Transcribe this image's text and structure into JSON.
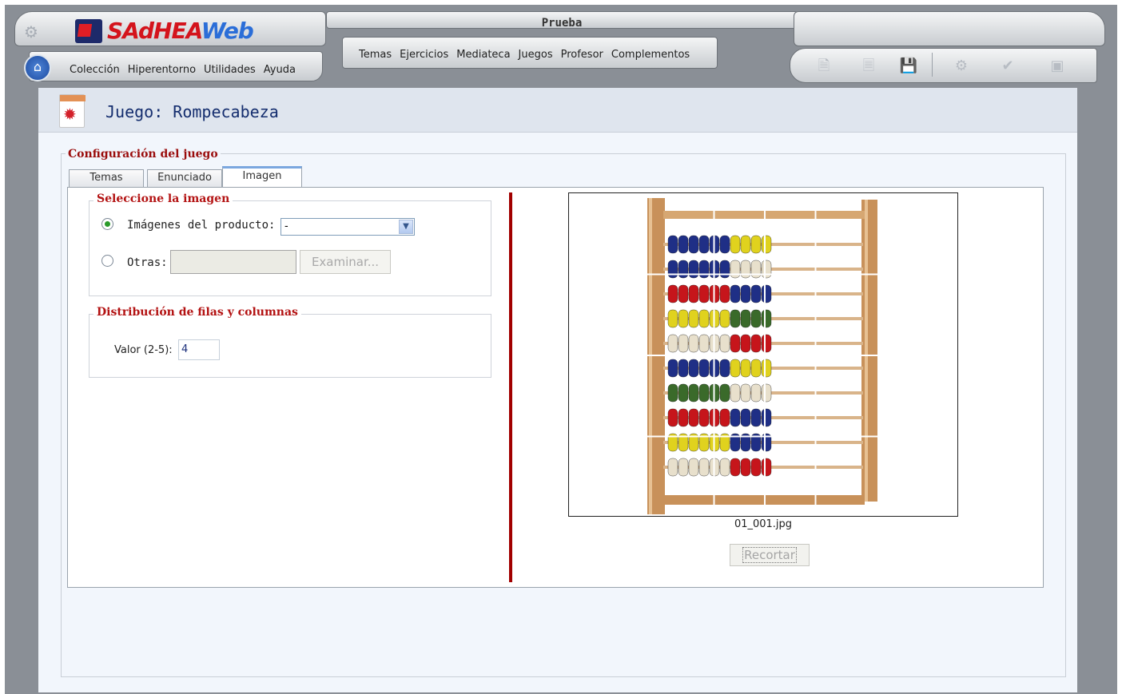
{
  "app": {
    "title": "Prueba",
    "logo_text_red": "SAdHEA",
    "logo_text_blue": "Web"
  },
  "menus": {
    "main": [
      "Colección",
      "Hiperentorno",
      "Utilidades",
      "Ayuda"
    ],
    "secondary": [
      "Temas",
      "Ejercicios",
      "Mediateca",
      "Juegos",
      "Profesor",
      "Complementos"
    ]
  },
  "toolbar": {
    "icons": [
      "new-document-icon",
      "delete-document-icon",
      "save-icon",
      "settings-icon",
      "check-icon",
      "options-icon"
    ]
  },
  "page": {
    "title": "Juego: Rompecabeza"
  },
  "config": {
    "legend": "Configuración del juego",
    "tabs": [
      "Temas",
      "Enunciado",
      "Imagen"
    ],
    "active_tab": "Imagen"
  },
  "image_section": {
    "legend": "Seleccione la imagen",
    "option_producto": "Imágenes del producto:",
    "option_otras": "Otras:",
    "selected_option": "producto",
    "select_value": "-",
    "otras_value": "",
    "examinar_label": "Examinar..."
  },
  "dist_section": {
    "legend": "Distribución de filas y columnas",
    "valor_label": "Valor (2-5):",
    "valor_value": "4"
  },
  "preview": {
    "filename": "01_001.jpg",
    "recortar_label": "Recortar",
    "grid_divisions": 4,
    "bead_colors": [
      "#1f2f86",
      "#e0d21e",
      "#e3d9c3",
      "#c6151b",
      "#3a6a2a",
      "#1f2f86",
      "#e0d21e",
      "#3a6a2a",
      "#c6151b",
      "#1f2f86",
      "#e0d21e",
      "#c6151b"
    ],
    "frame_color": "#c8915a"
  }
}
